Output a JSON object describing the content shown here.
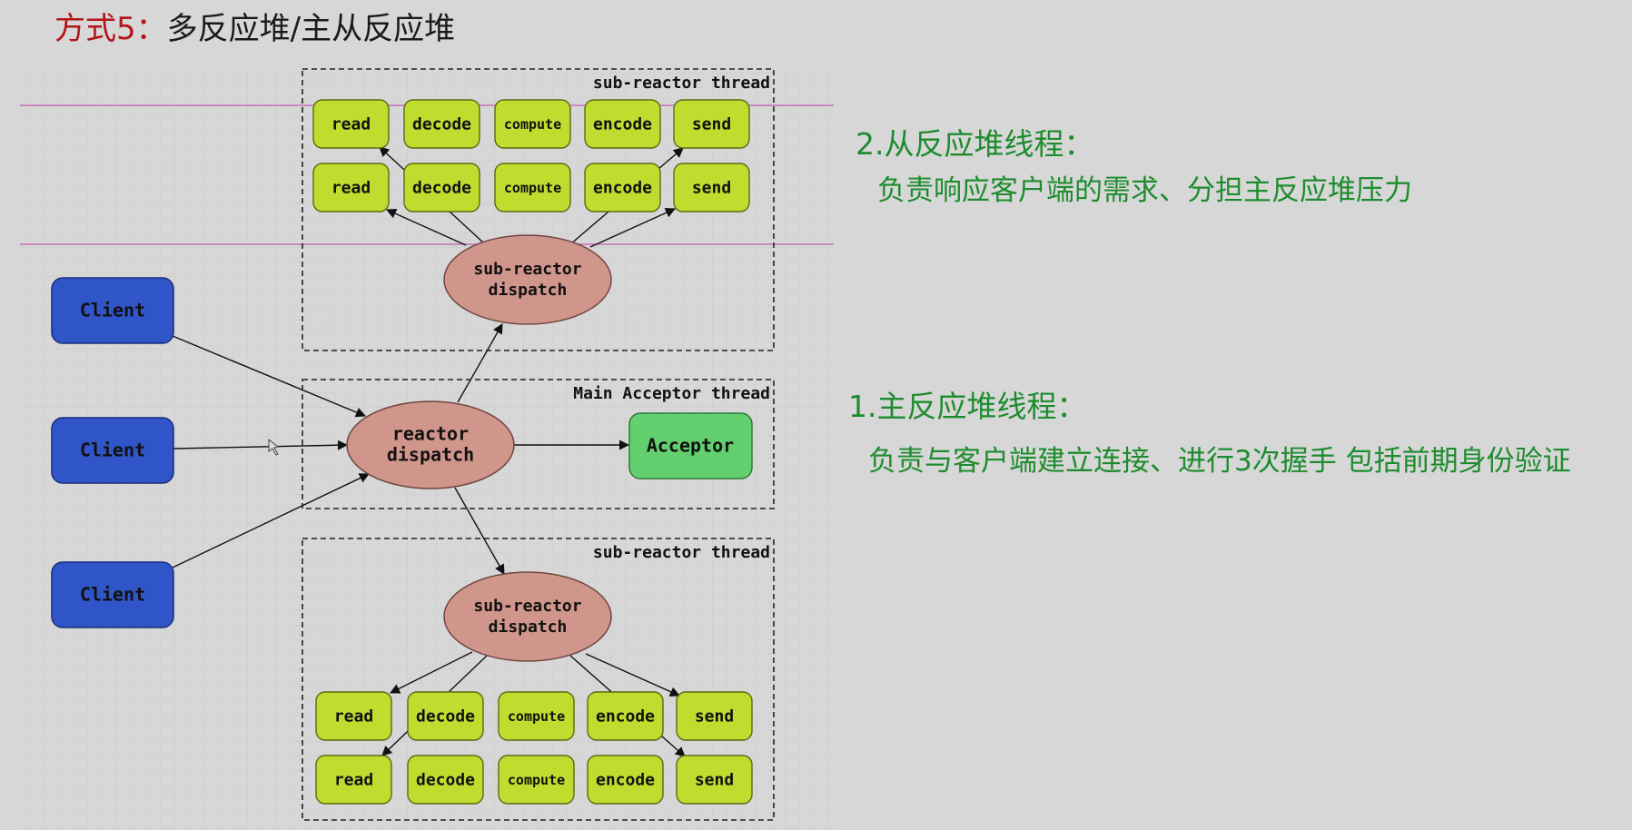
{
  "title": {
    "prefix": "方式5：",
    "text": "多反应堆/主从反应堆"
  },
  "diagram": {
    "top_group_label": "sub-reactor thread",
    "main_group_label": "Main Acceptor thread",
    "bottom_group_label": "sub-reactor thread",
    "clients": [
      "Client",
      "Client",
      "Client"
    ],
    "main_dispatch": [
      "reactor",
      "dispatch"
    ],
    "acceptor": "Acceptor",
    "sub_dispatch": [
      "sub-reactor",
      "dispatch"
    ],
    "task_rows": {
      "top": [
        [
          "read",
          "decode",
          "compute",
          "encode",
          "send"
        ],
        [
          "read",
          "decode",
          "compute",
          "encode",
          "send"
        ]
      ],
      "bottom": [
        [
          "read",
          "decode",
          "compute",
          "encode",
          "send"
        ],
        [
          "read",
          "decode",
          "compute",
          "encode",
          "send"
        ]
      ]
    }
  },
  "notes": {
    "sub_heading": "2.从反应堆线程：",
    "sub_text": "负责响应客户端的需求、分担主反应堆压力",
    "main_heading": "1.主反应堆线程：",
    "main_text": "负责与客户端建立连接、进行3次握手 包括前期身份验证"
  },
  "colors": {
    "client": "#2f55c9",
    "task": "#bedd2f",
    "dispatch": "#d0958b",
    "acceptor": "#63d06f",
    "note_text": "#1e8c2e",
    "title_prefix": "#b3141b",
    "guide_line": "#c45ab3"
  }
}
